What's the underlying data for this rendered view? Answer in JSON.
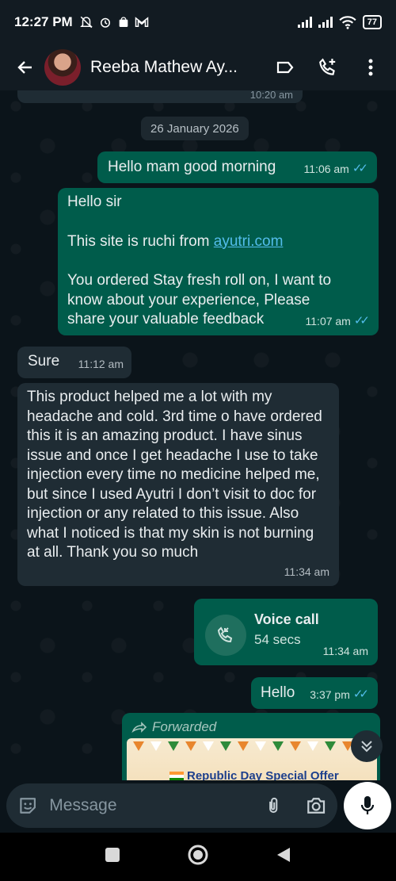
{
  "status_bar": {
    "time": "12:27 PM",
    "battery": "77"
  },
  "header": {
    "contact_name": "Reeba Mathew Ay..."
  },
  "chat": {
    "previous_time": "10:20 am",
    "date_chip": "26 January 2026",
    "messages": [
      {
        "text": "Hello mam good morning",
        "time": "11:06 am"
      },
      {
        "line1": "Hello sir",
        "line2_prefix": "This site is ruchi from ",
        "link": "ayutri.com",
        "line3": "You ordered Stay fresh roll on, I want to know about your experience, Please share your valuable feedback",
        "time": "11:07 am"
      },
      {
        "text": "Sure",
        "time": "11:12 am"
      },
      {
        "text": "This product helped me a lot with my headache and cold. 3rd time o have ordered this it is an amazing product.  I have sinus issue and once I get headache I use to take injection every time no medicine helped me, but since I used Ayutri I don’t visit to doc for injection or any related to this issue. Also what I noticed is that my skin is not burning at all.  Thank you so much",
        "time": "11:34 am"
      },
      {
        "call_title": "Voice call",
        "call_duration": "54 secs",
        "time": "11:34 am"
      },
      {
        "text": "Hello",
        "time": "3:37 pm"
      },
      {
        "forwarded_label": "Forwarded",
        "image_text": "Republic Day Special Offer"
      }
    ]
  },
  "composer": {
    "placeholder": "Message"
  },
  "colors": {
    "outgoing_bubble": "#005c4b",
    "incoming_bubble": "#1f2c34",
    "read_ticks": "#53bdeb",
    "link": "#53bdeb"
  }
}
